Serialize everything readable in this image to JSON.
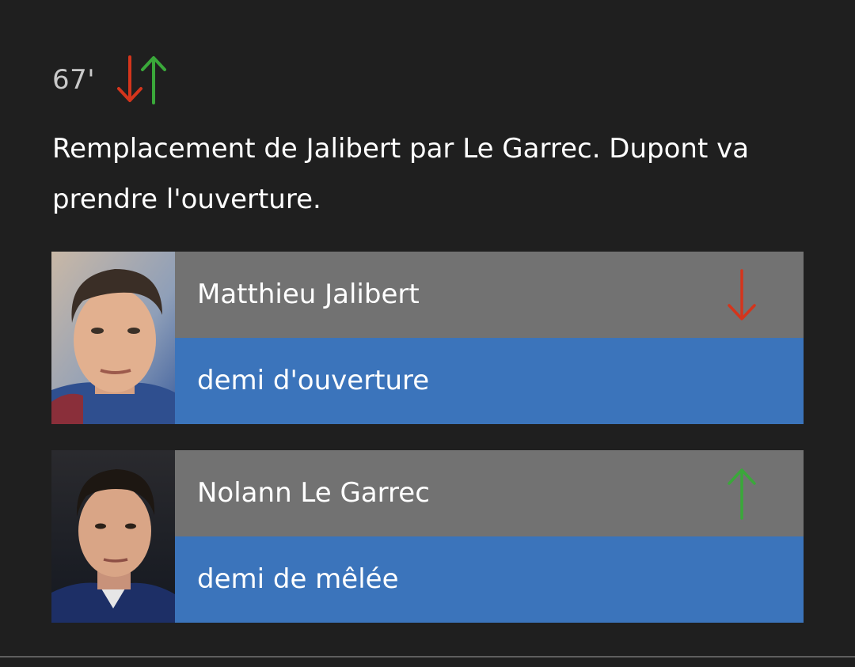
{
  "event": {
    "minute": "67'",
    "icon": "substitution-arrows-icon",
    "description": "Remplacement de Jalibert par Le Garrec. Dupont va prendre l'ouverture."
  },
  "players": [
    {
      "name": "Matthieu Jalibert",
      "position": "demi d'ouverture",
      "direction": "out",
      "direction_icon": "arrow-down-icon",
      "direction_color": "#d4351c"
    },
    {
      "name": "Nolann Le Garrec",
      "position": "demi de mêlée",
      "direction": "in",
      "direction_icon": "arrow-up-icon",
      "direction_color": "#3aa83a"
    }
  ],
  "colors": {
    "background": "#1f1f1f",
    "name_row": "#727272",
    "position_row": "#3b74bb",
    "out_arrow": "#d4351c",
    "in_arrow": "#3aa83a"
  }
}
